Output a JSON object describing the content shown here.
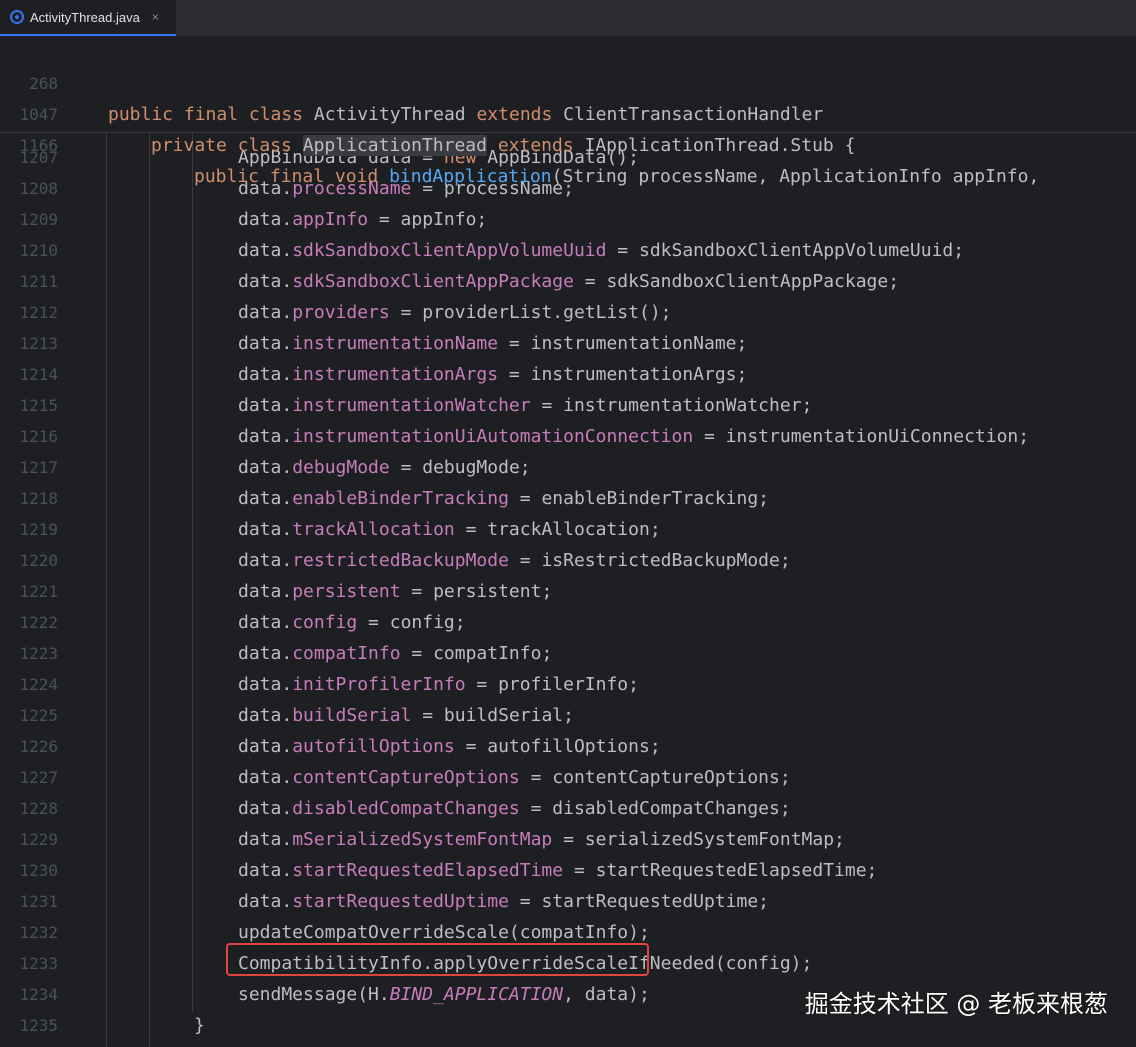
{
  "tab": {
    "title": "ActivityThread.java",
    "close": "×"
  },
  "sticky": [
    {
      "ln": "268",
      "code": "public final class ActivityThread extends ClientTransactionHandler"
    },
    {
      "ln": "1047",
      "code": "private class ApplicationThread extends IApplicationThread.Stub {"
    },
    {
      "ln": "1166",
      "code": "public final void bindApplication(String processName, ApplicationInfo appInfo,"
    }
  ],
  "lines": [
    {
      "ln": "1207",
      "pre": "AppBindData data = ",
      "kw": "new",
      "post": " AppBindData();"
    },
    {
      "ln": "1208",
      "field": "processName",
      "rhs": " = processName;"
    },
    {
      "ln": "1209",
      "field": "appInfo",
      "rhs": " = appInfo;"
    },
    {
      "ln": "1210",
      "field": "sdkSandboxClientAppVolumeUuid",
      "rhs": " = sdkSandboxClientAppVolumeUuid;"
    },
    {
      "ln": "1211",
      "field": "sdkSandboxClientAppPackage",
      "rhs": " = sdkSandboxClientAppPackage;"
    },
    {
      "ln": "1212",
      "field": "providers",
      "rhs": " = providerList.getList();"
    },
    {
      "ln": "1213",
      "field": "instrumentationName",
      "rhs": " = instrumentationName;"
    },
    {
      "ln": "1214",
      "field": "instrumentationArgs",
      "rhs": " = instrumentationArgs;"
    },
    {
      "ln": "1215",
      "field": "instrumentationWatcher",
      "rhs": " = instrumentationWatcher;"
    },
    {
      "ln": "1216",
      "field": "instrumentationUiAutomationConnection",
      "rhs": " = instrumentationUiConnection;"
    },
    {
      "ln": "1217",
      "field": "debugMode",
      "rhs": " = debugMode;"
    },
    {
      "ln": "1218",
      "field": "enableBinderTracking",
      "rhs": " = enableBinderTracking;"
    },
    {
      "ln": "1219",
      "field": "trackAllocation",
      "rhs": " = trackAllocation;"
    },
    {
      "ln": "1220",
      "field": "restrictedBackupMode",
      "rhs": " = isRestrictedBackupMode;"
    },
    {
      "ln": "1221",
      "field": "persistent",
      "rhs": " = persistent;"
    },
    {
      "ln": "1222",
      "field": "config",
      "rhs": " = config;"
    },
    {
      "ln": "1223",
      "field": "compatInfo",
      "rhs": " = compatInfo;"
    },
    {
      "ln": "1224",
      "field": "initProfilerInfo",
      "rhs": " = profilerInfo;"
    },
    {
      "ln": "1225",
      "field": "buildSerial",
      "rhs": " = buildSerial;"
    },
    {
      "ln": "1226",
      "field": "autofillOptions",
      "rhs": " = autofillOptions;"
    },
    {
      "ln": "1227",
      "field": "contentCaptureOptions",
      "rhs": " = contentCaptureOptions;"
    },
    {
      "ln": "1228",
      "field": "disabledCompatChanges",
      "rhs": " = disabledCompatChanges;"
    },
    {
      "ln": "1229",
      "field": "mSerializedSystemFontMap",
      "rhs": " = serializedSystemFontMap;"
    },
    {
      "ln": "1230",
      "field": "startRequestedElapsedTime",
      "rhs": " = startRequestedElapsedTime;"
    },
    {
      "ln": "1231",
      "field": "startRequestedUptime",
      "rhs": " = startRequestedUptime;"
    },
    {
      "ln": "1232",
      "plain": "updateCompatOverrideScale(compatInfo);"
    },
    {
      "ln": "1233",
      "plain": "CompatibilityInfo.applyOverrideScaleIfNeeded(config);"
    },
    {
      "ln": "1234",
      "pre": "sendMessage(H.",
      "italic": "BIND_APPLICATION",
      "post": ", data);"
    },
    {
      "ln": "1235",
      "brace": "}"
    }
  ],
  "watermark": "掘金技术社区 @ 老板来根葱",
  "colors": {
    "background": "#1e1f22",
    "keyword": "#cf8e6d",
    "field": "#c77dbb",
    "method": "#56a8f5",
    "highlight_box": "#e0443e"
  }
}
